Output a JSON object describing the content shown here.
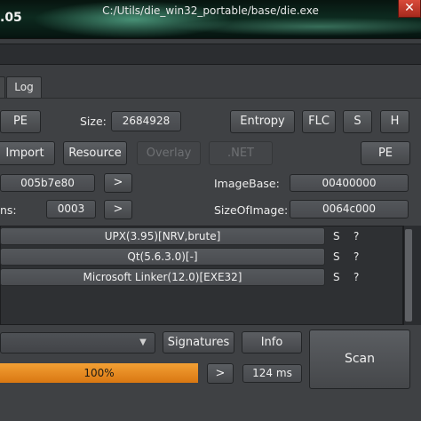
{
  "window": {
    "title_fragment": ".05",
    "close_glyph": "✕"
  },
  "file_path": "C:/Utils/die_win32_portable/base/die.exe",
  "tabs": [
    {
      "label": "Log"
    }
  ],
  "toolbar": {
    "pe_label": "PE",
    "size_label": "Size:",
    "size_value": "2684928",
    "entropy_label": "Entropy",
    "flc_label": "FLC",
    "s_label": "S",
    "h_label": "H"
  },
  "sections": {
    "import_label": "Import",
    "resource_label": "Resource",
    "overlay_label": "Overlay",
    "net_label": ".NET",
    "pe_label": "PE"
  },
  "info": {
    "entry_value": "005b7e80",
    "entry_arrow": ">",
    "image_base_label": "ImageBase:",
    "image_base_value": "00400000",
    "sections_label_fragment": "ns:",
    "sections_value": "0003",
    "sections_arrow": ">",
    "size_of_image_label": "SizeOfImage:",
    "size_of_image_value": "0064c000"
  },
  "detections": [
    {
      "name": "UPX(3.95)[NRV,brute]",
      "s": "S",
      "q": "?"
    },
    {
      "name": "Qt(5.6.3.0)[-]",
      "s": "S",
      "q": "?"
    },
    {
      "name": "Microsoft Linker(12.0)[EXE32]",
      "s": "S",
      "q": "?"
    }
  ],
  "bottom": {
    "combo_arrow": "▼",
    "signatures_label": "Signatures",
    "info_label": "Info",
    "scan_label": "Scan",
    "progress_percent": 100,
    "progress_text": "100%",
    "progress_arrow": ">",
    "time_value": "124 ms"
  },
  "colors": {
    "progress": "#e88a1a",
    "title_glow": "#78e6be"
  }
}
